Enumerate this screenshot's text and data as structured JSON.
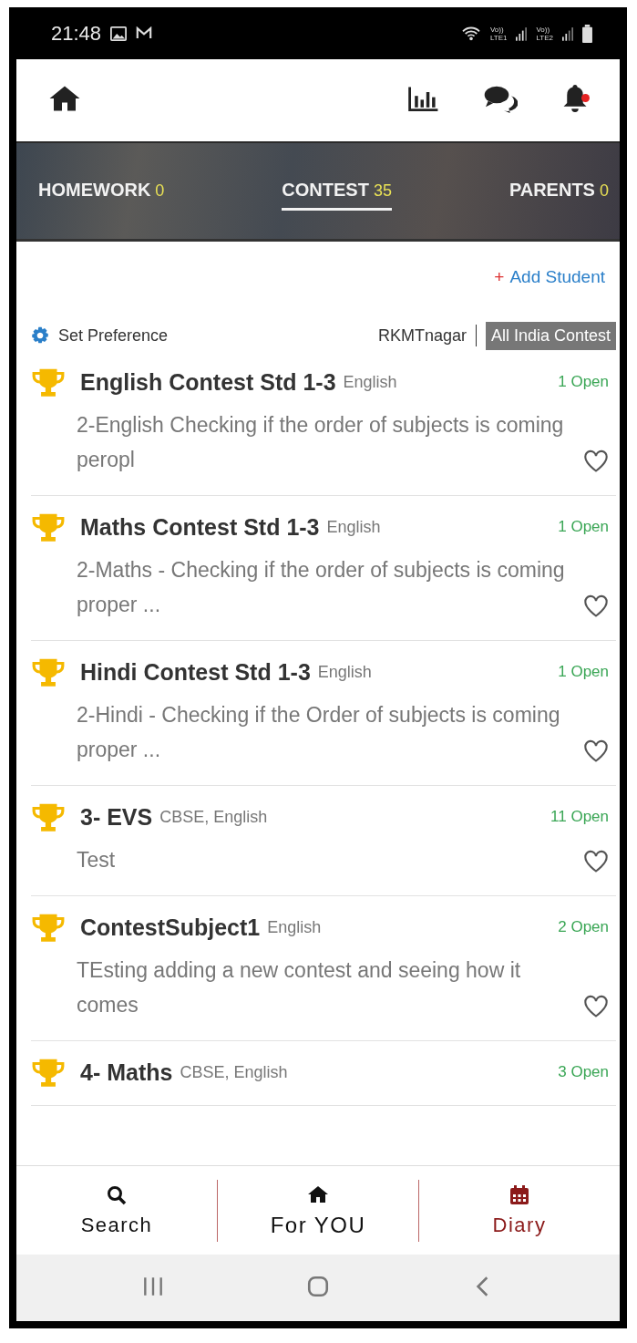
{
  "status_bar": {
    "time": "21:48",
    "sims": [
      {
        "top": "Vo))",
        "bottom": "LTE1"
      },
      {
        "top": "Vo))",
        "bottom": "LTE2"
      }
    ]
  },
  "header": {
    "notifications": true
  },
  "tabs": [
    {
      "label": "HOMEWORK",
      "count": "0",
      "selected": false
    },
    {
      "label": "CONTEST",
      "count": "35",
      "selected": true
    },
    {
      "label": "PARENTS",
      "count": "0",
      "selected": false
    }
  ],
  "add_student": {
    "icon": "+",
    "label": "Add Student"
  },
  "preference": {
    "label": "Set Preference",
    "location": "RKMTnagar",
    "scope": "All India Contest"
  },
  "contests": [
    {
      "title": "English Contest Std 1-3",
      "tags": "English",
      "open": "1 Open",
      "description": "2-English Checking if the order of subjects is coming peropl"
    },
    {
      "title": "Maths Contest Std 1-3",
      "tags": "English",
      "open": "1 Open",
      "description": "2-Maths - Checking if the order of subjects is coming proper ..."
    },
    {
      "title": "Hindi Contest Std 1-3",
      "tags": "English",
      "open": "1 Open",
      "description": "2-Hindi - Checking if the Order of subjects is coming proper ..."
    },
    {
      "title": "3- EVS",
      "tags": "CBSE, English",
      "open": "11 Open",
      "description": "Test"
    },
    {
      "title": "ContestSubject1",
      "tags": "English",
      "open": "2 Open",
      "description": "TEsting adding a new contest and seeing how it comes"
    },
    {
      "title": "4- Maths",
      "tags": "CBSE, English",
      "open": "3 Open"
    }
  ],
  "bottom_nav": [
    {
      "kind": "search",
      "label": "Search",
      "color": "#111111"
    },
    {
      "kind": "home",
      "label": "For YOU",
      "color": "#111111"
    },
    {
      "kind": "diary",
      "label": "Diary",
      "color": "#8b1a1a"
    }
  ]
}
